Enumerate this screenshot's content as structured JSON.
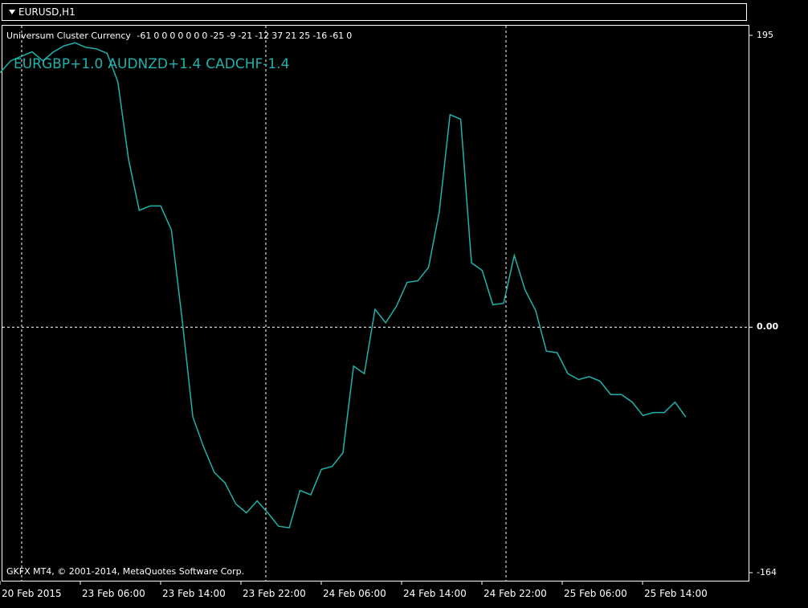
{
  "window": {
    "title": "EURUSD,H1"
  },
  "indicator": {
    "name": "Universum Cluster Currency",
    "values": [
      "-61",
      "0",
      "0",
      "0",
      "0",
      "0",
      "0",
      "0",
      "-25",
      "-9",
      "-21",
      "-12",
      "37",
      "21",
      "25",
      "-16",
      "-61",
      "0"
    ]
  },
  "symbols": [
    "EURGBP+1.0",
    "AUDNZD+1.4",
    "CADCHF-1.4"
  ],
  "copyright": "GKFX MT4, © 2001-2014, MetaQuotes Software Corp.",
  "colors": {
    "background": "#000000",
    "line": "#20b2aa",
    "grid": "#ffffff"
  },
  "chart_data": {
    "type": "line",
    "ylim": [
      -164,
      195
    ],
    "yticks": [
      195,
      0.0,
      -164
    ],
    "ytick_labels": [
      "195",
      "0.00",
      "-164"
    ],
    "xtick_labels": [
      "20 Feb 2015",
      "23 Feb 06:00",
      "23 Feb 14:00",
      "23 Feb 22:00",
      "24 Feb 06:00",
      "24 Feb 14:00",
      "24 Feb 22:00",
      "25 Feb 06:00",
      "25 Feb 14:00"
    ],
    "grid": true,
    "series": [
      {
        "values": [
          170,
          178,
          181,
          184,
          178,
          184,
          188,
          190,
          187,
          186,
          183,
          164,
          112,
          78,
          81,
          81,
          65,
          5,
          -60,
          -80,
          -97,
          -104,
          -118,
          -124,
          -116,
          -124,
          -133,
          -134,
          -109,
          -112,
          -95,
          -93,
          -84,
          -26,
          -31,
          12,
          3,
          14,
          30,
          31,
          40,
          77,
          142,
          139,
          43,
          38,
          15,
          16,
          48,
          25,
          11,
          -16,
          -17,
          -31,
          -35,
          -33,
          -36,
          -45,
          -45,
          -50,
          -59,
          -57,
          -57,
          -50,
          -60
        ]
      }
    ]
  }
}
